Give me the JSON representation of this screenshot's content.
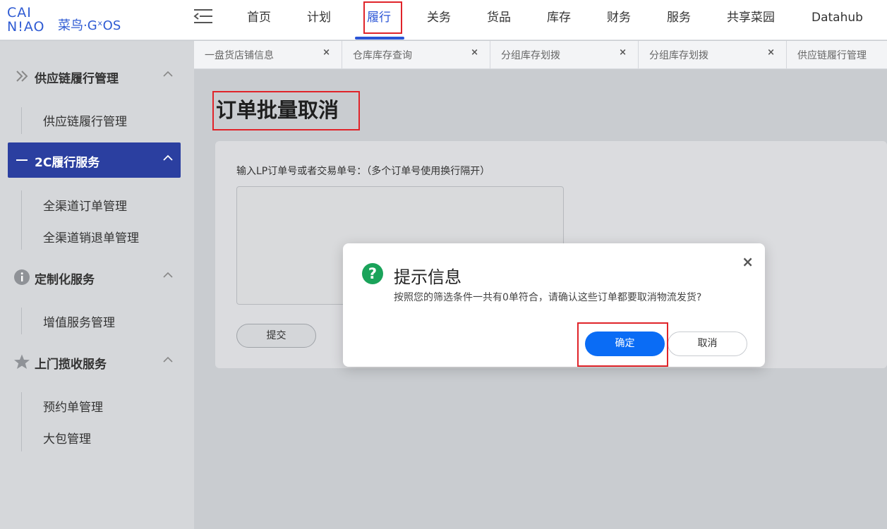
{
  "logo": {
    "line1": "CAI",
    "line2": "N!AO",
    "text": "菜鸟·GˣOS"
  },
  "nav": {
    "items": [
      "首页",
      "计划",
      "履行",
      "关务",
      "货品",
      "库存",
      "财务",
      "服务",
      "共享菜园",
      "Datahub"
    ],
    "active": "履行"
  },
  "tabs": [
    {
      "label": "一盘货店铺信息",
      "close": "×"
    },
    {
      "label": "仓库库存查询",
      "close": "×"
    },
    {
      "label": "分组库存划拨",
      "close": "×"
    },
    {
      "label": "分组库存划拨",
      "close": "×"
    },
    {
      "label": "供应链履行管理",
      "close": ""
    }
  ],
  "sidebar": {
    "sections": [
      {
        "title": "供应链履行管理",
        "icon": "double-chevron-icon",
        "items": [
          "供应链履行管理"
        ]
      },
      {
        "title": "2C履行服务",
        "icon": "dash-icon",
        "active": true,
        "items": [
          "全渠道订单管理",
          "全渠道销退单管理"
        ]
      },
      {
        "title": "定制化服务",
        "icon": "info-icon",
        "items": [
          "增值服务管理"
        ]
      },
      {
        "title": "上门揽收服务",
        "icon": "star-icon",
        "items": [
          "预约单管理",
          "大包管理"
        ]
      }
    ]
  },
  "main": {
    "title": "订单批量取消",
    "field_label": "输入LP订单号或者交易单号：（多个订单号使用换行隔开）",
    "textarea_value": "",
    "submit_label": "提交"
  },
  "modal": {
    "title": "提示信息",
    "message": "按照您的筛选条件一共有0单符合，请确认这些订单都要取消物流发货?",
    "ok_label": "确定",
    "cancel_label": "取消",
    "close": "×",
    "icon_glyph": "?"
  },
  "colors": {
    "brand": "#2b55d6",
    "primary_button": "#0a6cf5",
    "success_icon": "#1aa35a",
    "highlight": "#e0242a"
  }
}
